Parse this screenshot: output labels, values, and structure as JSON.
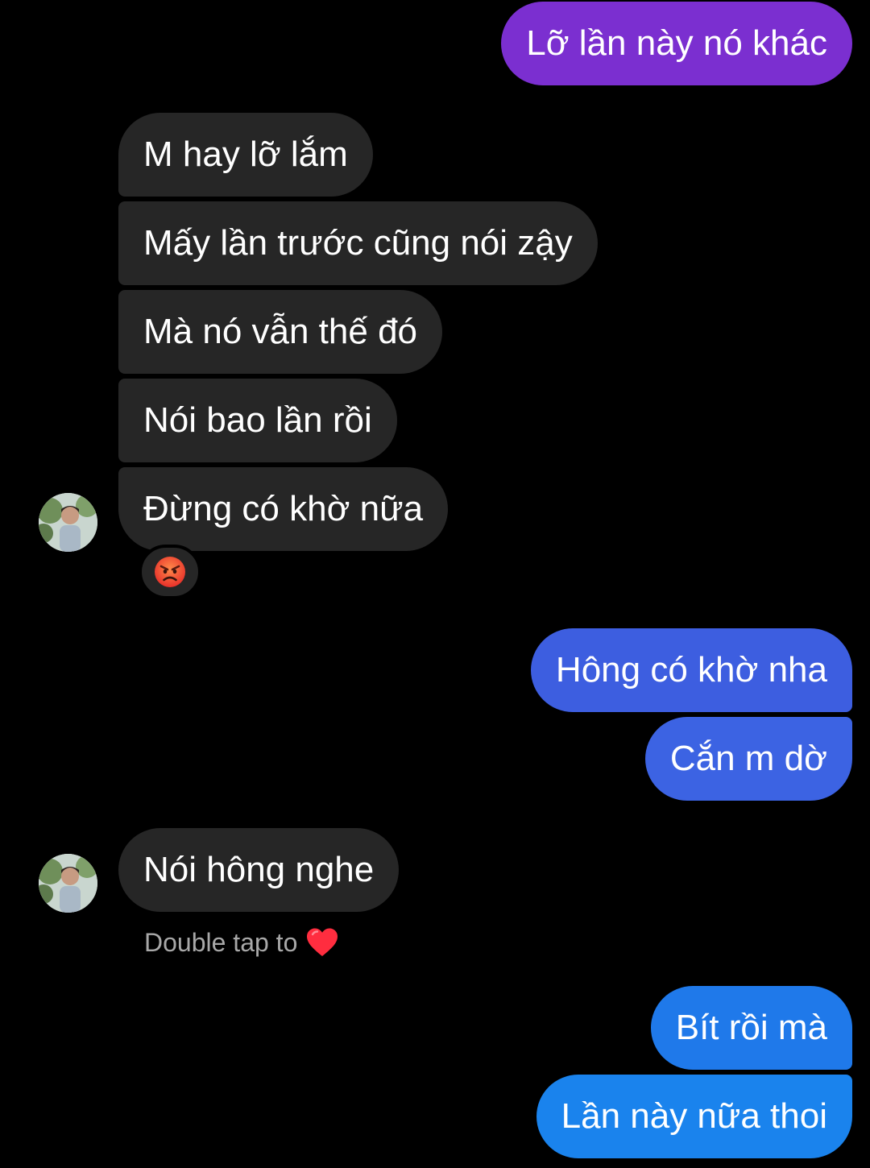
{
  "thread": {
    "messages": [
      {
        "id": "m1",
        "direction": "outgoing",
        "text": "Lỡ lần này nó khác",
        "color": "#7b2fd0"
      },
      {
        "id": "m2",
        "direction": "incoming",
        "text": "M hay lỡ lắm"
      },
      {
        "id": "m3",
        "direction": "incoming",
        "text": "Mấy lần trước cũng nói zậy"
      },
      {
        "id": "m4",
        "direction": "incoming",
        "text": "Mà nó vẫn thế đó"
      },
      {
        "id": "m5",
        "direction": "incoming",
        "text": "Nói bao lần rồi"
      },
      {
        "id": "m6",
        "direction": "incoming",
        "text": "Đừng có khờ nữa",
        "reaction": "angry-face-emoji"
      },
      {
        "id": "m7",
        "direction": "outgoing",
        "text": "Hông có khờ nha",
        "color": "#3d5ee0"
      },
      {
        "id": "m8",
        "direction": "outgoing",
        "text": "Cắn m dờ",
        "color": "#3c63e3"
      },
      {
        "id": "m9",
        "direction": "incoming",
        "text": "Nói hông nghe"
      },
      {
        "id": "m10",
        "direction": "outgoing",
        "text": "Bít rồi mà",
        "color": "#1f79ea"
      },
      {
        "id": "m11",
        "direction": "outgoing",
        "text": "Lần này nữa thoi",
        "color": "#1a83ed"
      }
    ],
    "hint": {
      "text": "Double tap to",
      "icon": "heart-icon",
      "icon_color": "#ff2d3f"
    },
    "colors": {
      "background": "#000000",
      "incoming_bubble": "#262626",
      "hint_text": "#a8a8a8"
    }
  }
}
